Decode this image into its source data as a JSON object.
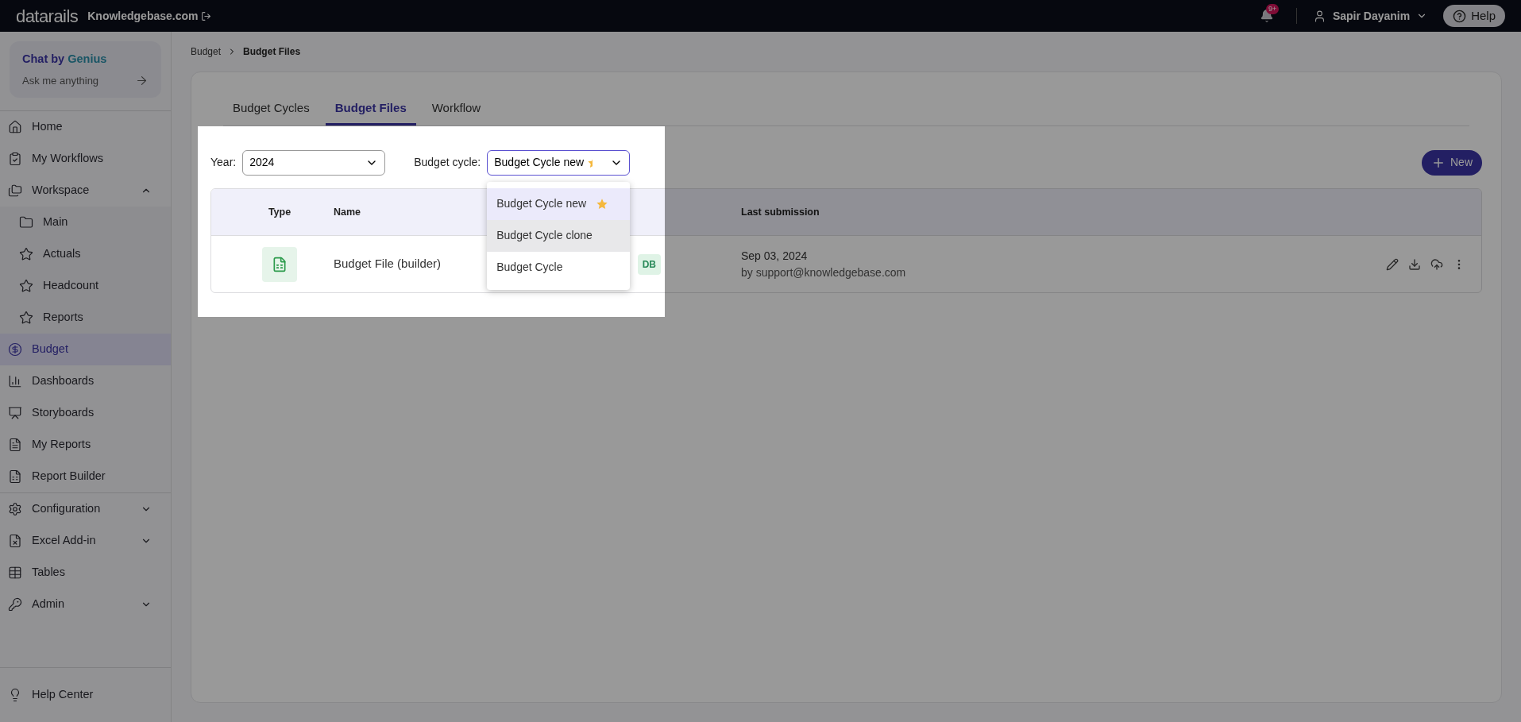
{
  "topbar": {
    "logo": "datarails",
    "workspace": "Knowledgebase.com",
    "notification_count": "9+",
    "user": "Sapir Dayanim",
    "help": "Help"
  },
  "chat": {
    "title": "Chat by",
    "brand": "Genius",
    "prompt": "Ask me anything"
  },
  "sidebar": {
    "sections": [
      {
        "items": [
          {
            "label": "Home",
            "kind": "link",
            "selected": false
          },
          {
            "label": "My Workflows",
            "kind": "link",
            "selected": false
          },
          {
            "label": "Workspace",
            "kind": "group",
            "selected": false,
            "expanded": true,
            "children": [
              {
                "label": "Main",
                "selected": false
              },
              {
                "label": "Actuals",
                "selected": false
              },
              {
                "label": "Headcount",
                "selected": false
              },
              {
                "label": "Reports",
                "selected": false
              }
            ]
          },
          {
            "label": "Budget",
            "kind": "link",
            "selected": true
          },
          {
            "label": "Dashboards",
            "kind": "link",
            "selected": false
          },
          {
            "label": "Storyboards",
            "kind": "link",
            "selected": false
          },
          {
            "label": "My Reports",
            "kind": "link",
            "selected": false
          },
          {
            "label": "Report Builder",
            "kind": "link",
            "selected": false
          }
        ]
      },
      {
        "items": [
          {
            "label": "Configuration",
            "kind": "group",
            "selected": false,
            "expanded": false
          },
          {
            "label": "Excel Add-in",
            "kind": "group",
            "selected": false,
            "expanded": false
          },
          {
            "label": "Tables",
            "kind": "link",
            "selected": false
          },
          {
            "label": "Admin",
            "kind": "group",
            "selected": false,
            "expanded": false
          }
        ]
      }
    ],
    "footer": {
      "label": "Help Center"
    }
  },
  "breadcrumb": [
    "Budget",
    "Budget Files"
  ],
  "tabs": [
    {
      "label": "Budget Cycles",
      "selected": false
    },
    {
      "label": "Budget Files",
      "selected": true
    },
    {
      "label": "Workflow",
      "selected": false
    }
  ],
  "filters": {
    "year": {
      "label": "Year:",
      "value": "2024"
    },
    "cycle": {
      "label": "Budget cycle:",
      "value": "Budget Cycle new",
      "favorite": true,
      "open": true,
      "options": [
        {
          "label": "Budget Cycle new",
          "favorite": true,
          "selected": true,
          "hovered": false
        },
        {
          "label": "Budget Cycle clone",
          "favorite": false,
          "selected": false,
          "hovered": true
        },
        {
          "label": "Budget Cycle",
          "favorite": false,
          "selected": false,
          "hovered": false
        }
      ]
    }
  },
  "new_button": "New",
  "table": {
    "columns": [
      "Type",
      "Name",
      "Last submission"
    ],
    "rows": [
      {
        "name": "Budget File (builder)",
        "status": "DB",
        "date": "Sep 03, 2024",
        "by": "by support@knowledgebase.com"
      }
    ]
  },
  "spotlight": true
}
